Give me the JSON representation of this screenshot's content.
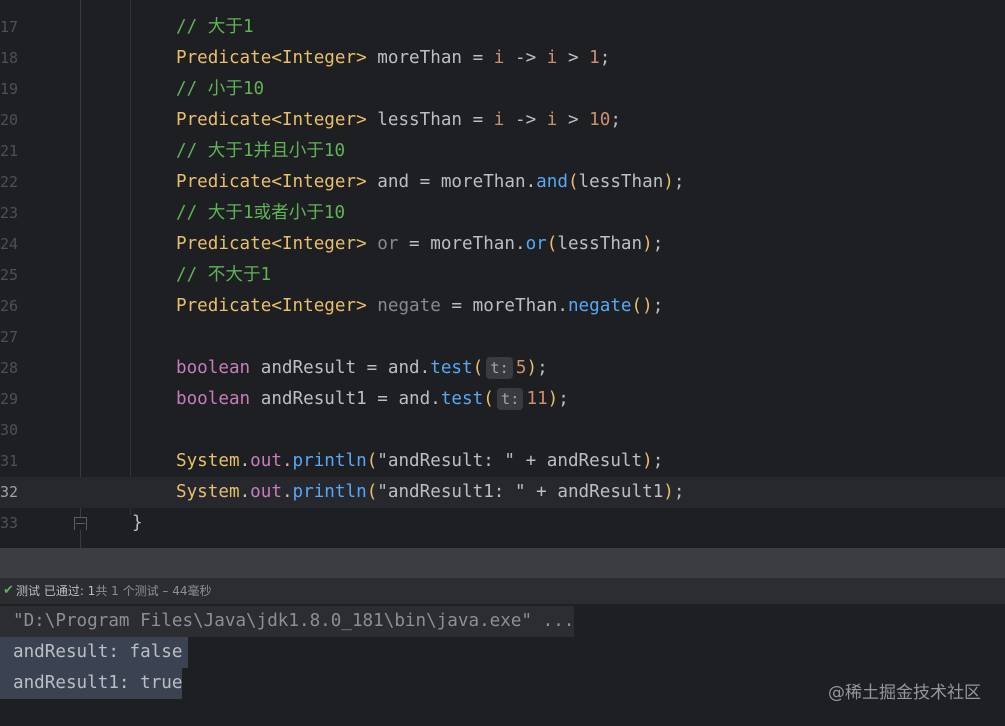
{
  "editor": {
    "line_numbers": [
      "17",
      "18",
      "19",
      "20",
      "21",
      "22",
      "23",
      "24",
      "25",
      "26",
      "27",
      "28",
      "29",
      "30",
      "31",
      "32",
      "33"
    ],
    "comments": {
      "c1": "// 大于1",
      "c2": "// 小于10",
      "c3": "// 大于1并且小于10",
      "c4": "// 大于1或者小于10",
      "c5": "// 不大于1"
    },
    "type_decl": "Predicate<Integer>",
    "vars": {
      "more": "moreThan",
      "less": "lessThan",
      "and": "and",
      "or": "or",
      "negate": "negate",
      "andResult": "andResult",
      "andResult1": "andResult1",
      "i": "i"
    },
    "keywords": {
      "boolean": "boolean"
    },
    "methods": {
      "and": "and",
      "or": "or",
      "negate": "negate",
      "test": "test",
      "println": "println"
    },
    "numbers": {
      "one": "1",
      "ten": "10",
      "five": "5",
      "eleven": "11"
    },
    "hints": {
      "t": "t:"
    },
    "system": {
      "class": "System",
      "out": "out"
    },
    "strings": {
      "s1": "\"andResult: \"",
      "s2": "\"andResult1: \""
    },
    "closing_brace": "}"
  },
  "run_panel": {
    "status_label": "测试 已通过:",
    "status_count": " 1",
    "status_detail": "共 1 个测试 – 44毫秒"
  },
  "console": {
    "command": "\"D:\\Program Files\\Java\\jdk1.8.0_181\\bin\\java.exe\" ...",
    "output": [
      "andResult: false",
      "andResult1: true"
    ]
  },
  "watermark": "@稀土掘金技术社区",
  "colors": {
    "background": "#1e1f22",
    "comment": "#5fb356",
    "type": "#e8bf6a",
    "method": "#56a8f5",
    "field": "#c77dbb",
    "number": "#2aacb8",
    "string": "#6aab73"
  }
}
